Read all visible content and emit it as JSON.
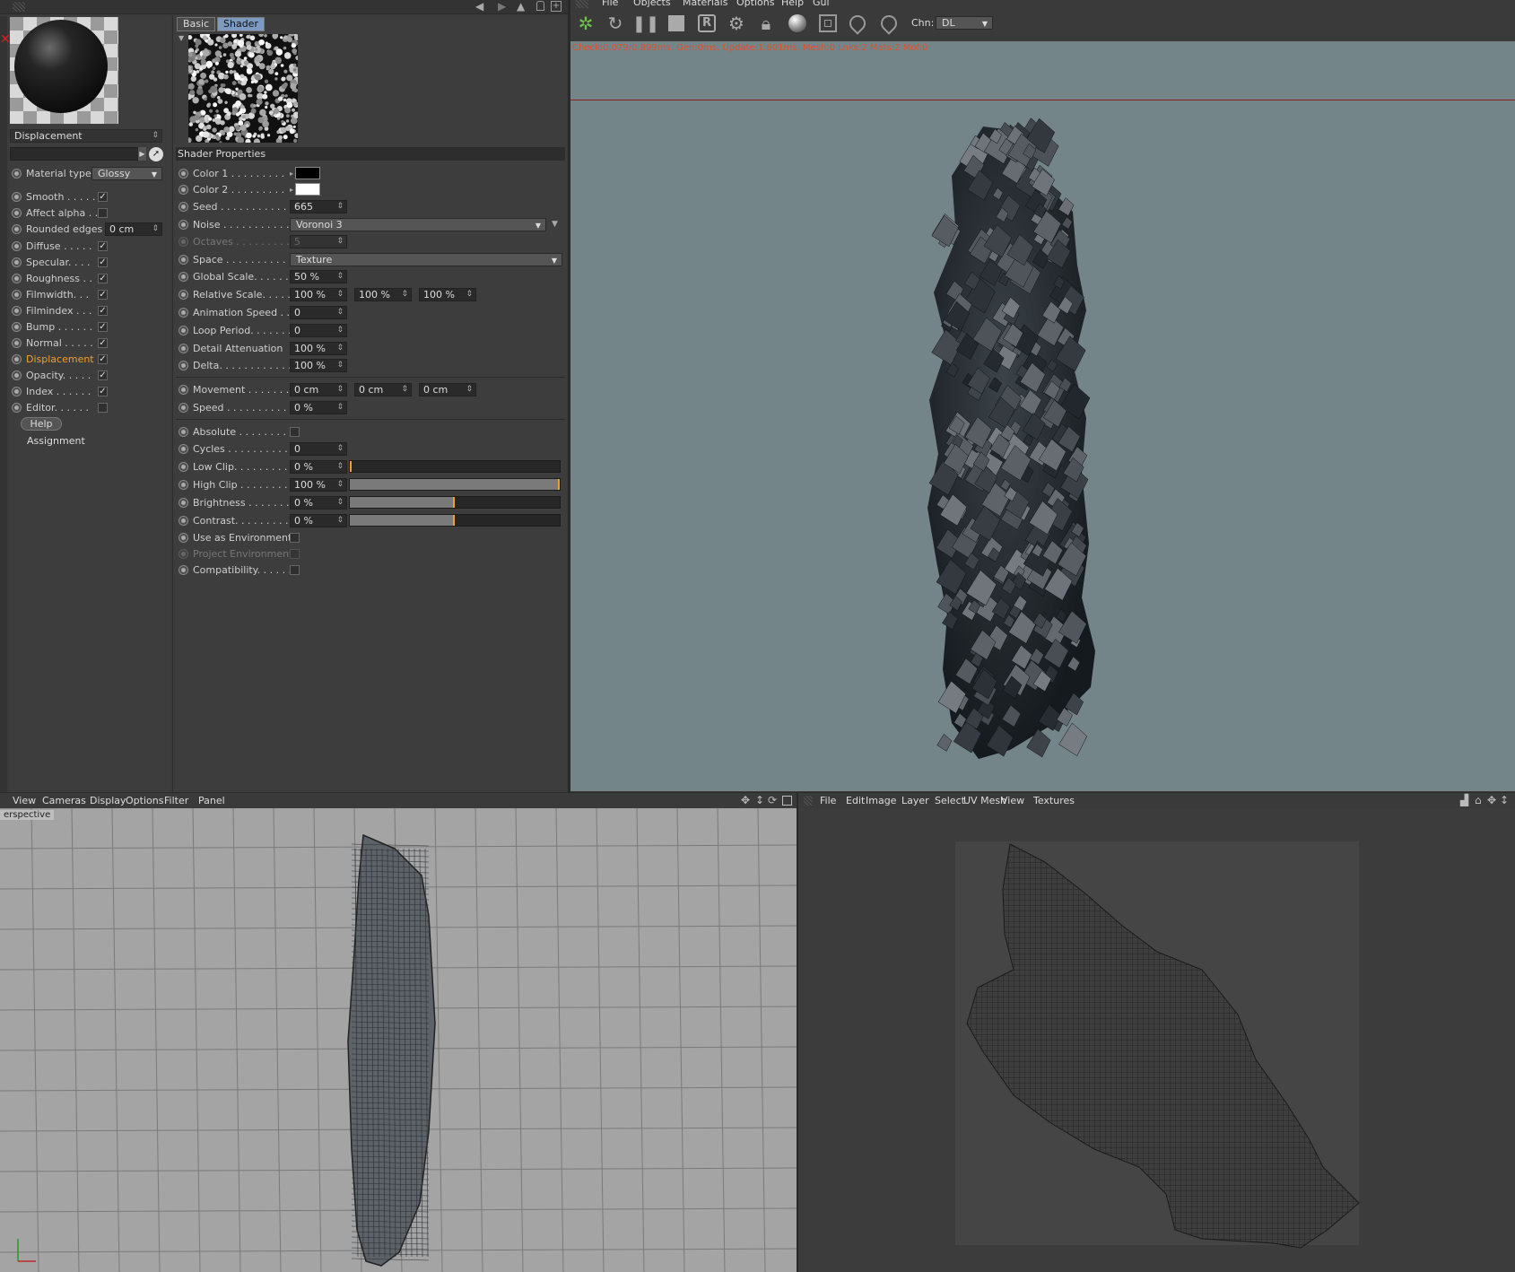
{
  "material": {
    "name_field": "Displacement",
    "material_type_label": "Material type",
    "material_type_value": "Glossy",
    "channels": [
      {
        "label": "Smooth . . . . . .",
        "checked": true
      },
      {
        "label": "Affect alpha . . .",
        "checked": false
      },
      {
        "label": "Rounded edges",
        "value": "0 cm"
      },
      {
        "label": "Diffuse . . . . .",
        "checked": true
      },
      {
        "label": "Specular. . . .",
        "checked": true
      },
      {
        "label": "Roughness . .",
        "checked": true
      },
      {
        "label": "Filmwidth. . .",
        "checked": true
      },
      {
        "label": "Filmindex . . .",
        "checked": true
      },
      {
        "label": "Bump . . . . . .",
        "checked": true
      },
      {
        "label": "Normal . . . . .",
        "checked": true
      },
      {
        "label": "Displacement",
        "checked": true,
        "active": true
      },
      {
        "label": "Opacity. . . . .",
        "checked": true
      },
      {
        "label": "Index . . . . . .",
        "checked": true
      },
      {
        "label": "Editor. . . . . .",
        "checked": false
      }
    ],
    "help_label": "Help",
    "assignment_label": "Assignment",
    "active_color": "#f0a030"
  },
  "shader": {
    "tabs": [
      "Basic",
      "Shader"
    ],
    "section_title": "Shader Properties",
    "props": {
      "color1": {
        "label": "Color 1 . . . . . . . . .",
        "color": "#000000"
      },
      "color2": {
        "label": "Color 2 . . . . . . . . .",
        "color": "#ffffff"
      },
      "seed": {
        "label": "Seed . . . . . . . . . . . . .",
        "value": "665"
      },
      "noise": {
        "label": "Noise . . . . . . . . . . . .",
        "value": "Voronoi 3"
      },
      "octaves": {
        "label": "Octaves . . . . . . . . . .",
        "value": "5"
      },
      "space": {
        "label": "Space . . . . . . . . . . . .",
        "value": "Texture"
      },
      "global_scale": {
        "label": "Global Scale. . . . . . .",
        "value": "50 %"
      },
      "relative_scale": {
        "label": "Relative Scale. . . . . .",
        "values": [
          "100 %",
          "100 %",
          "100 %"
        ]
      },
      "animation_speed": {
        "label": "Animation Speed . .",
        "value": "0"
      },
      "loop_period": {
        "label": "Loop Period. . . . . . .",
        "value": "0"
      },
      "detail_attenuation": {
        "label": "Detail Attenuation",
        "value": "100 %"
      },
      "delta": {
        "label": "Delta. . . . . . . . . . . . .",
        "value": "100 %"
      },
      "movement": {
        "label": "Movement . . . . . . . .",
        "values": [
          "0 cm",
          "0 cm",
          "0 cm"
        ]
      },
      "speed": {
        "label": "Speed . . . . . . . . . . . .",
        "value": "0 %"
      },
      "absolute": {
        "label": "Absolute . . . . . . . . .",
        "checked": false
      },
      "cycles": {
        "label": "Cycles . . . . . . . . . . . .",
        "value": "0"
      },
      "low_clip": {
        "label": "Low Clip. . . . . . . . . .",
        "value": "0 %",
        "level": 0
      },
      "high_clip": {
        "label": "High Clip . . . . . . . . .",
        "value": "100 %",
        "level": 1
      },
      "brightness": {
        "label": "Brightness . . . . . . . .",
        "value": "0 %",
        "level": 0.5
      },
      "contrast": {
        "label": "Contrast. . . . . . . . . .",
        "value": "0 %",
        "level": 0.5
      },
      "use_env": {
        "label": "Use as Environment",
        "checked": false
      },
      "project_env": {
        "label": "Project Environment",
        "checked": false
      },
      "compat": {
        "label": "Compatibility. . . . . .",
        "checked": false
      }
    }
  },
  "render_view": {
    "menu": [
      "File",
      "Objects",
      "Materials",
      "Options",
      "Help",
      "Gui"
    ],
    "channel_label": "Chn:",
    "channel_value": "DL",
    "status": "Check:0.079/0.899ms. Gen:0ms. Update:1.801ms. Mesh:0 Lnks:2 Mats:2 Mof:0",
    "status_color": "#e0502a"
  },
  "viewport": {
    "menu": [
      "View",
      "Cameras",
      "Display",
      "Options",
      "Filter",
      "Panel"
    ],
    "camera_label": "erspective"
  },
  "uv_editor": {
    "menu": [
      "File",
      "Edit",
      "Image",
      "Layer",
      "Select",
      "UV Mesh",
      "View",
      "Textures"
    ]
  }
}
